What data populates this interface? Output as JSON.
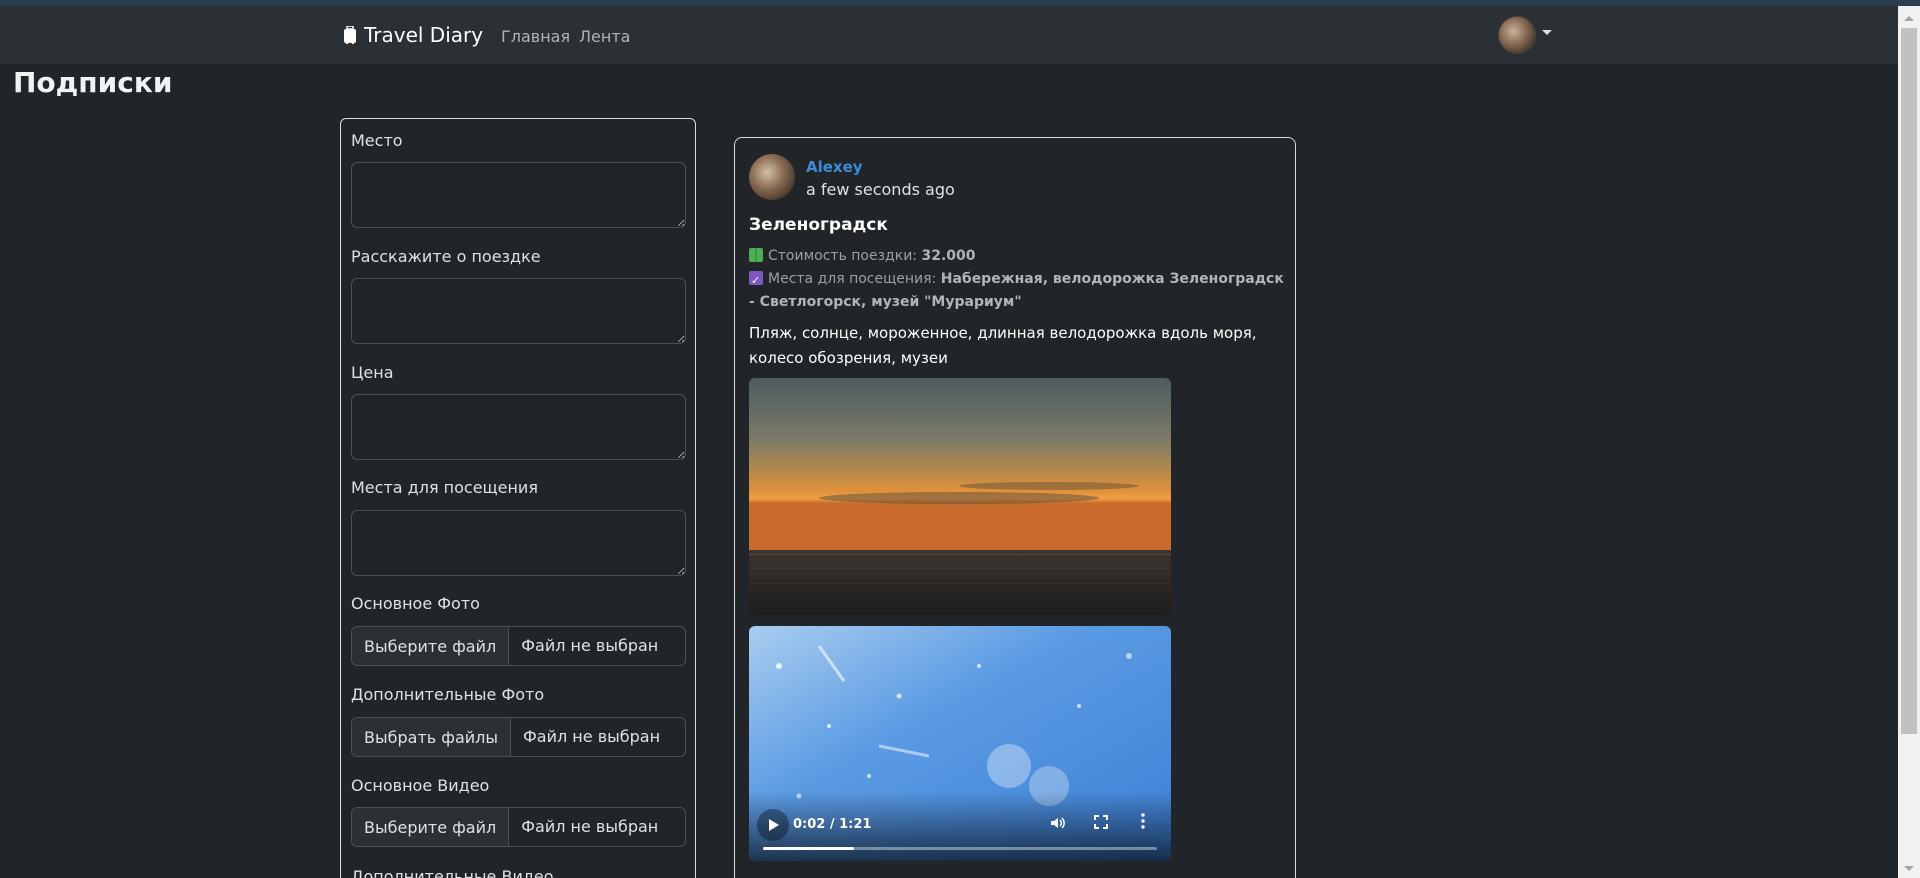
{
  "app": {
    "brand": "Travel Diary",
    "nav": {
      "home": "Главная",
      "feed": "Лента"
    }
  },
  "page": {
    "title": "Подписки"
  },
  "form": {
    "place_label": "Место",
    "story_label": "Расскажите о поездке",
    "price_label": "Цена",
    "places_label": "Места для посещения",
    "main_photo_label": "Основное Фото",
    "main_photo_button": "Выберите файл",
    "main_photo_status": "Файл не выбран",
    "extra_photos_label": "Дополнительные Фото",
    "extra_photos_button": "Выбрать файлы",
    "extra_photos_status": "Файл не выбран",
    "main_video_label": "Основное Видео",
    "main_video_button": "Выберите файл",
    "main_video_status": "Файл не выбран",
    "extra_video_label": "Дополнительные Видео"
  },
  "post": {
    "author": "Alexey",
    "time": "a few seconds ago",
    "title": "Зеленоградск",
    "cost_label": "Стоимость поездки:",
    "cost_value": "32.000",
    "places_label": "Места для посещения:",
    "places_value": "Набережная, велодорожка Зеленоградск - Светлогорск, музей \"Мурариум\"",
    "description": "Пляж, солнце, мороженное, длинная велодорожка вдоль моря, колесо обозрения, музеи",
    "video": {
      "time": "0:02 / 1:21",
      "progress": 0.23
    }
  },
  "colors": {
    "background": "#212529",
    "navbar": "#2b3035",
    "link": "#3d8bd4"
  }
}
